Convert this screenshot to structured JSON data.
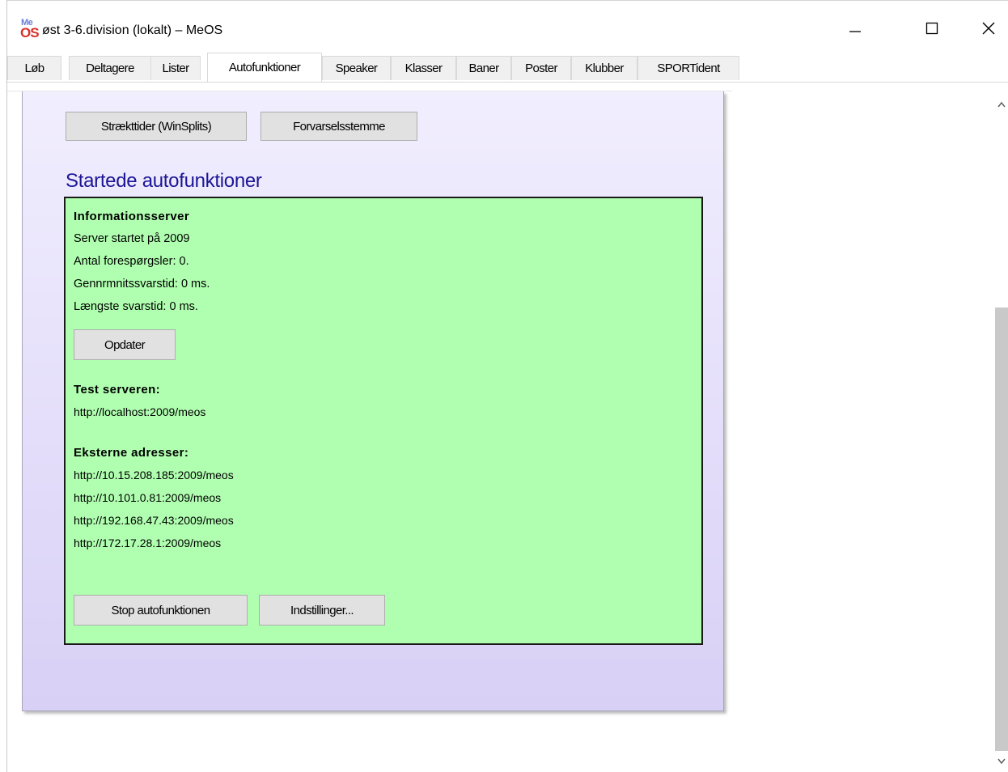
{
  "window": {
    "logo_top": "Me",
    "logo_bottom": "OS",
    "title": "øst 3-6.division (lokalt) – MeOS"
  },
  "tabs": [
    {
      "label": "Løb"
    },
    {
      "label": "Deltagere"
    },
    {
      "label": "Lister"
    },
    {
      "label": "Autofunktioner"
    },
    {
      "label": "Speaker"
    },
    {
      "label": "Klasser"
    },
    {
      "label": "Baner"
    },
    {
      "label": "Poster"
    },
    {
      "label": "Klubber"
    },
    {
      "label": "SPORTident"
    }
  ],
  "active_tab": "Autofunktioner",
  "toolbar": {
    "split_times_label": "Strækttider (WinSplits)",
    "warning_voice_label": "Forvarselsstemme"
  },
  "section_title": "Startede autofunktioner",
  "info_server": {
    "heading": "Informationsserver",
    "started": "Server startet på 2009",
    "requests": "Antal forespørgsler: 0.",
    "avg_response": "Gennrmnitssvarstid: 0 ms.",
    "max_response": "Længste svarstid: 0 ms.",
    "update_label": "Opdater",
    "test_heading": "Test serveren:",
    "test_url": "http://localhost:2009/meos",
    "external_heading": "Eksterne adresser:",
    "external_urls": [
      "http://10.15.208.185:2009/meos",
      "http://10.101.0.81:2009/meos",
      "http://192.168.47.43:2009/meos",
      "http://172.17.28.1:2009/meos"
    ],
    "stop_label": "Stop autofunktionen",
    "settings_label": "Indstillinger..."
  },
  "colors": {
    "section_title": "#1c1696",
    "info_box_bg": "#b0ffb0",
    "panel_top": "#f1eefe",
    "panel_bottom": "#d8d0f5"
  }
}
